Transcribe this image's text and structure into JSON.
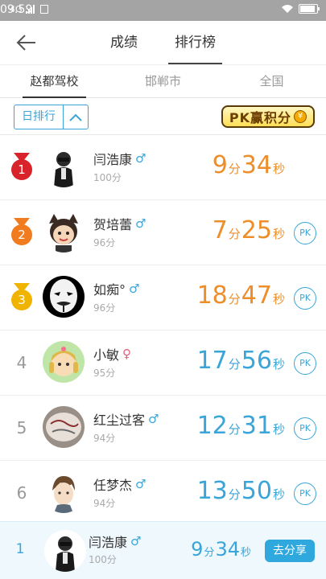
{
  "status": {
    "network": "4G",
    "time": "09:59"
  },
  "header": {
    "tabs": [
      {
        "label": "成绩"
      },
      {
        "label": "排行榜"
      }
    ]
  },
  "subtabs": [
    {
      "label": "赵都驾校"
    },
    {
      "label": "邯郸市"
    },
    {
      "label": "全国"
    }
  ],
  "filter": {
    "selected": "日排行",
    "banner": "PK赢积分",
    "coin": "¥"
  },
  "ranking": [
    {
      "rank": "1",
      "name": "闫浩康",
      "sex": "♂",
      "score": "100分",
      "min": "9",
      "sec": "34",
      "pk": ""
    },
    {
      "rank": "2",
      "name": "贺培蕾",
      "sex": "♂",
      "score": "96分",
      "min": "7",
      "sec": "25",
      "pk": "PK"
    },
    {
      "rank": "3",
      "name": "如痴°",
      "sex": "♂",
      "score": "96分",
      "min": "18",
      "sec": "47",
      "pk": "PK"
    },
    {
      "rank": "4",
      "name": "小敏",
      "sex": "♀",
      "score": "95分",
      "min": "17",
      "sec": "56",
      "pk": "PK"
    },
    {
      "rank": "5",
      "name": "红尘过客",
      "sex": "♂",
      "score": "94分",
      "min": "12",
      "sec": "31",
      "pk": "PK"
    },
    {
      "rank": "6",
      "name": "任梦杰",
      "sex": "♂",
      "score": "94分",
      "min": "13",
      "sec": "50",
      "pk": "PK"
    }
  ],
  "units": {
    "min": "分",
    "sec": "秒"
  },
  "me": {
    "rank": "1",
    "name": "闫浩康",
    "sex": "♂",
    "score": "100分",
    "min": "9",
    "sec": "34",
    "share": "去分享"
  },
  "colors": {
    "accent": "#3aa5d8",
    "orange": "#ed8e2b",
    "gold": "#f0b400",
    "silver_bronze": "#f07c1f",
    "red": "#d9232b"
  }
}
